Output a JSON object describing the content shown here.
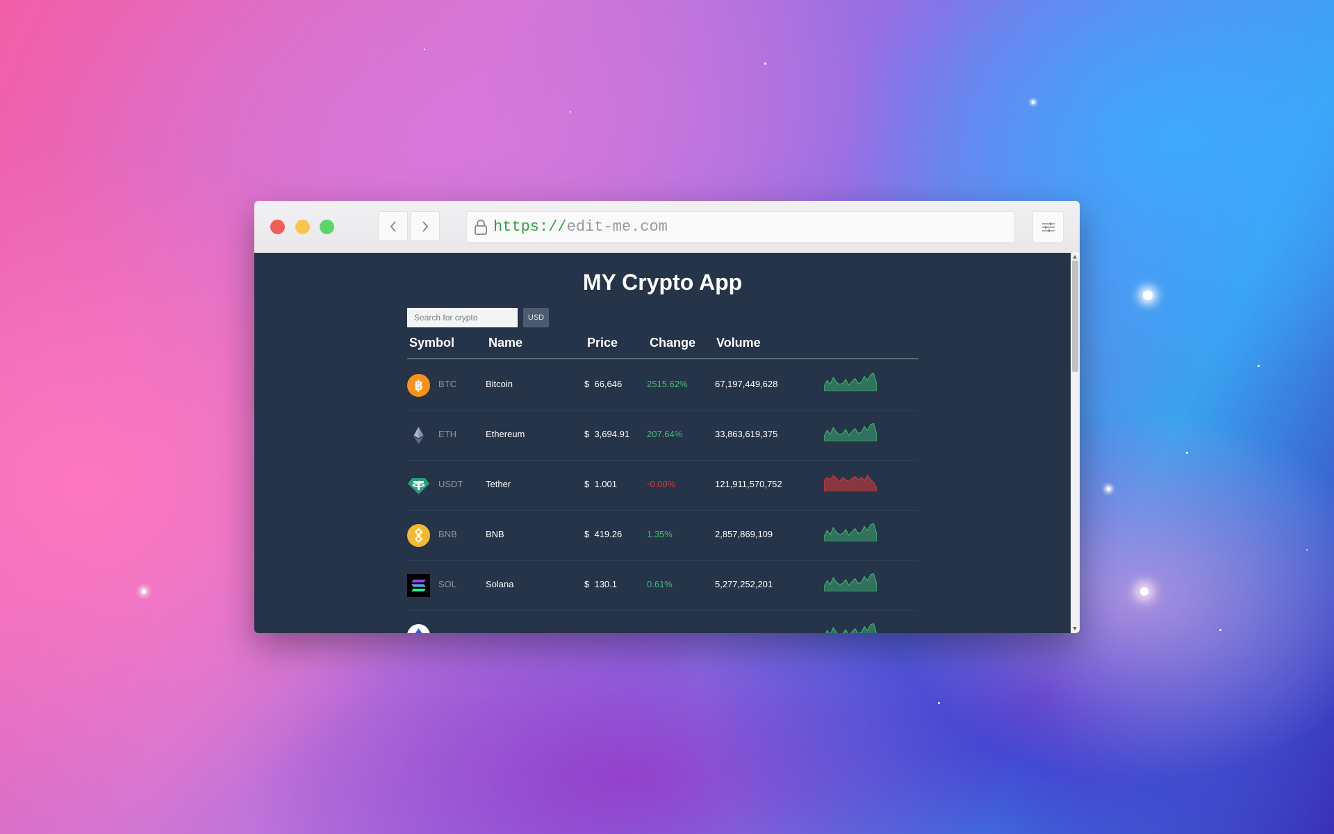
{
  "browser": {
    "url_scheme": "https://",
    "url_host": "edit-me.com"
  },
  "app": {
    "title": "MY Crypto App",
    "search_placeholder": "Search for crypto",
    "currency": "USD",
    "columns": [
      "Symbol",
      "Name",
      "Price",
      "Change",
      "Volume"
    ],
    "currency_symbol": "$",
    "colors": {
      "positive": "#3fbf73",
      "negative": "#d63a3a",
      "background": "#263449"
    },
    "rows": [
      {
        "symbol": "BTC",
        "name": "Bitcoin",
        "price": "66,646",
        "change": "2515.62%",
        "trend": "up",
        "volume": "67,197,449,628",
        "icon": "bitcoin-icon"
      },
      {
        "symbol": "ETH",
        "name": "Ethereum",
        "price": "3,694.91",
        "change": "207.64%",
        "trend": "up",
        "volume": "33,863,619,375",
        "icon": "ethereum-icon"
      },
      {
        "symbol": "USDT",
        "name": "Tether",
        "price": "1.001",
        "change": "-0.00%",
        "trend": "down",
        "volume": "121,911,570,752",
        "icon": "tether-icon"
      },
      {
        "symbol": "BNB",
        "name": "BNB",
        "price": "419.26",
        "change": "1.35%",
        "trend": "up",
        "volume": "2,857,869,109",
        "icon": "bnb-icon"
      },
      {
        "symbol": "SOL",
        "name": "Solana",
        "price": "130.1",
        "change": "0.61%",
        "trend": "up",
        "volume": "5,277,252,201",
        "icon": "solana-icon"
      },
      {
        "symbol": "",
        "name": "",
        "price": "",
        "change": "",
        "trend": "up",
        "volume": "",
        "icon": "token-icon"
      }
    ]
  }
}
